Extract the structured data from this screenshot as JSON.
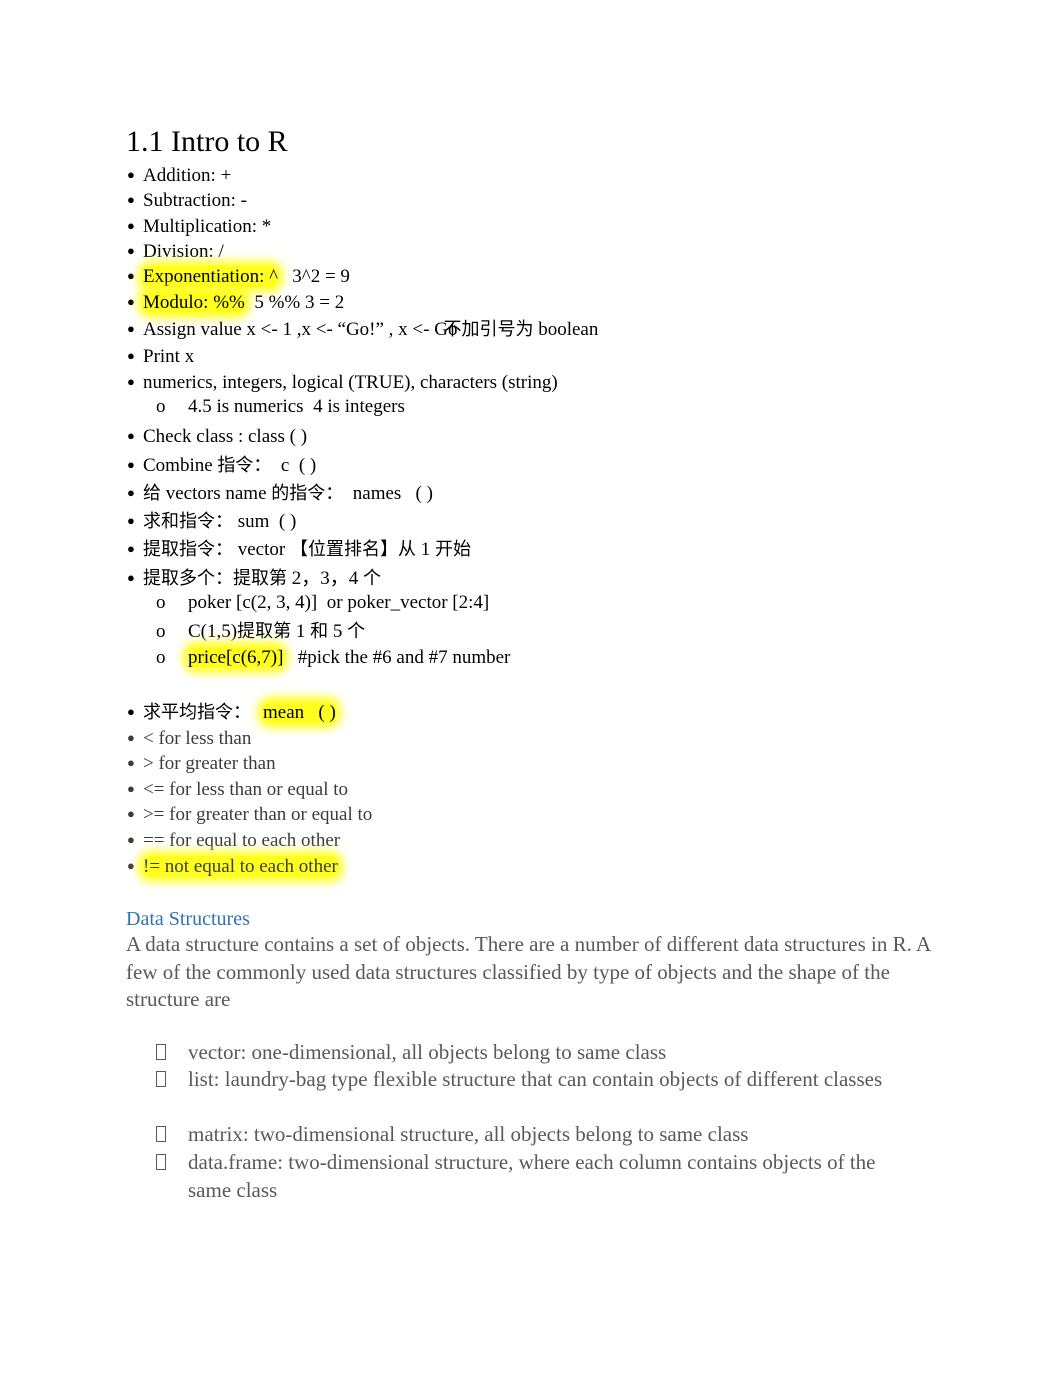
{
  "title": "1.1 Intro to R",
  "bullet_glyph": "●",
  "sub_glyph": "o",
  "lines": [
    {
      "text": "Addition: +"
    },
    {
      "text": "Subtraction: -"
    },
    {
      "text": "Multiplication: *"
    },
    {
      "text": "Division: /"
    },
    {
      "highlight": "Exponentiation: ^",
      "rest": "   3^2 = 9"
    },
    {
      "highlight": "Modulo: %%",
      "rest": "  5 %% 3 = 2"
    },
    {
      "text": "Assign value x <- 1 ,x <- “Go!” , x <- Go",
      "cjk": "不加引号为",
      "tail": " boolean"
    },
    {
      "text": "Print x"
    },
    {
      "text": "numerics, integers, logical (TRUE), characters (string)"
    },
    {
      "text": "Check class : class ( )"
    },
    {
      "text": "Combine ",
      "cjk": "指令：",
      "tail": "  c  ( )"
    },
    {
      "cjk_pre": "给",
      "text": " vectors name ",
      "cjk": "的指令：",
      "tail": "  names   ( )"
    },
    {
      "cjk": "求和指令：",
      "tail": " sum  ( )"
    },
    {
      "cjk": "提取指令：",
      "tail": " vector ",
      "cjk2": "【位置排名】从",
      "tail2": " 1 ",
      "cjk3": "开始"
    },
    {
      "cjk": "提取多个：提取第",
      "tail": " 2，3，4 ",
      "cjk2": "个"
    },
    {
      "cjk": "求平均指令：",
      "highlight": "mean   ( )"
    },
    {
      "text": "< for less than"
    },
    {
      "text": "> for greater than"
    },
    {
      "text": "<= for less than or equal to"
    },
    {
      "text": ">= for greater than or equal to"
    },
    {
      "text": "== for equal to each other"
    },
    {
      "highlight": "!= not equal to each other"
    }
  ],
  "sublines": [
    {
      "text": "4.5 is numerics  4 is integers"
    },
    {
      "text": "poker [c(2, 3, 4)]  or poker_vector [2:4]"
    },
    {
      "text": "C(1,5)",
      "cjk": "提取第",
      "tail": " 1 ",
      "cjk2": "和",
      "tail2": " 5 ",
      "cjk3": "个"
    },
    {
      "highlight": "price[c(6,7)]",
      "rest": "   #pick the #6 and #7 number"
    }
  ],
  "data_structures": {
    "heading": "Data Structures",
    "paragraph": "A data structure contains a set of objects. There are a number of different data structures in R. A few of the commonly used data structures classified by type of objects and the shape of the structure are",
    "items": [
      "vector: one-dimensional, all objects belong to same class",
      "list: laundry-bag type flexible structure that can contain objects of different classes",
      "matrix: two-dimensional structure, all objects belong to same class",
      "data.frame: two-dimensional structure, where each column contains objects of the same class"
    ]
  }
}
